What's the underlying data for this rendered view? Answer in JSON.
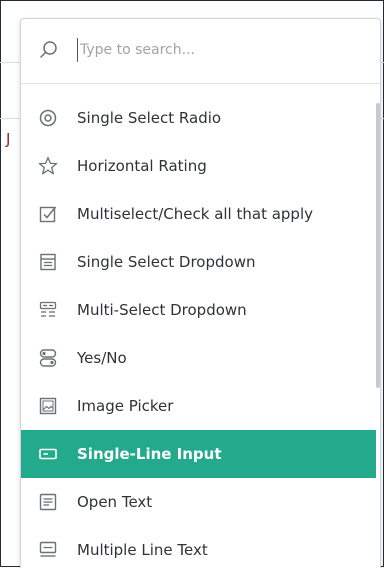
{
  "search": {
    "placeholder": "Type to search...",
    "value": ""
  },
  "items": [
    {
      "label": "Single Select Radio",
      "icon": "radio-icon"
    },
    {
      "label": "Horizontal Rating",
      "icon": "star-icon"
    },
    {
      "label": "Multiselect/Check all that apply",
      "icon": "checkbox-icon"
    },
    {
      "label": "Single Select Dropdown",
      "icon": "dropdown-list-icon"
    },
    {
      "label": "Multi-Select Dropdown",
      "icon": "multi-dropdown-icon"
    },
    {
      "label": "Yes/No",
      "icon": "toggle-icon"
    },
    {
      "label": "Image Picker",
      "icon": "image-icon"
    },
    {
      "label": "Single-Line Input",
      "icon": "single-line-input-icon",
      "selected": true
    },
    {
      "label": "Open Text",
      "icon": "text-lines-icon"
    },
    {
      "label": "Multiple Line Text",
      "icon": "multi-line-text-icon"
    }
  ],
  "colors": {
    "accent": "#23a98b",
    "text": "#2f3337",
    "icon": "#6b7177",
    "border": "#1f2d3a"
  }
}
